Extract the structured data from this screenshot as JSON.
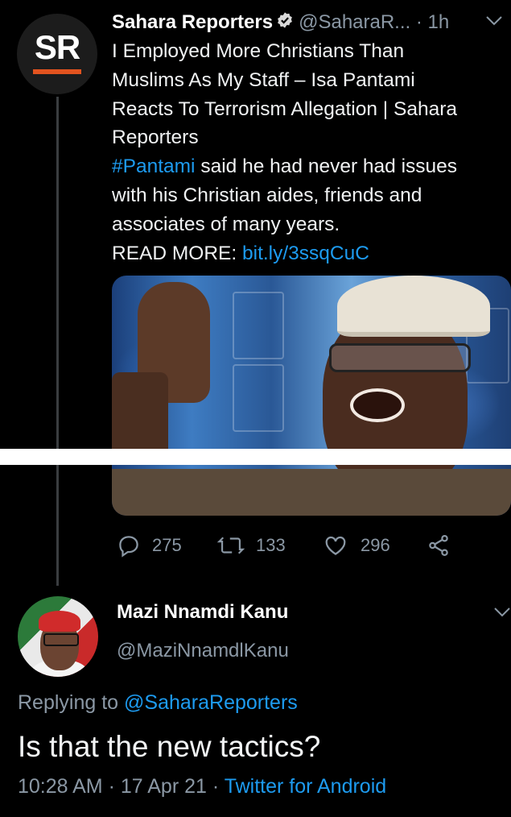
{
  "tweet": {
    "avatar_text": "SR",
    "name": "Sahara Reporters",
    "handle": "@SaharaR...",
    "time": "· 1h",
    "body_lines": [
      "I Employed More Christians Than",
      "Muslims As My Staff – Isa Pantami",
      "Reacts To Terrorism Allegation | Sahara",
      "Reporters"
    ],
    "hashtag": "#Pantami",
    "body_after_hashtag": " said he had never had issues",
    "body_lines2": [
      "with his Christian aides, friends and",
      "associates of many years."
    ],
    "read_more_label": "READ MORE: ",
    "read_more_link": "bit.ly/3ssqCuC",
    "replies": "275",
    "retweets": "133",
    "likes": "296"
  },
  "reply": {
    "name": "Mazi Nnamdi Kanu",
    "handle": "@MaziNnamdlKanu",
    "replying_label": "Replying to ",
    "replying_to": "@SaharaReporters",
    "text": "Is that the new tactics?",
    "time": "10:28 AM",
    "date": "17 Apr 21",
    "source": "Twitter for Android"
  },
  "colors": {
    "background": "#000000",
    "link": "#1d9bf0",
    "muted": "#8b98a5",
    "sr_accent": "#e2531f"
  },
  "icons": [
    "verified-badge-icon",
    "chevron-down-icon",
    "reply-icon",
    "retweet-icon",
    "like-icon",
    "share-icon"
  ]
}
